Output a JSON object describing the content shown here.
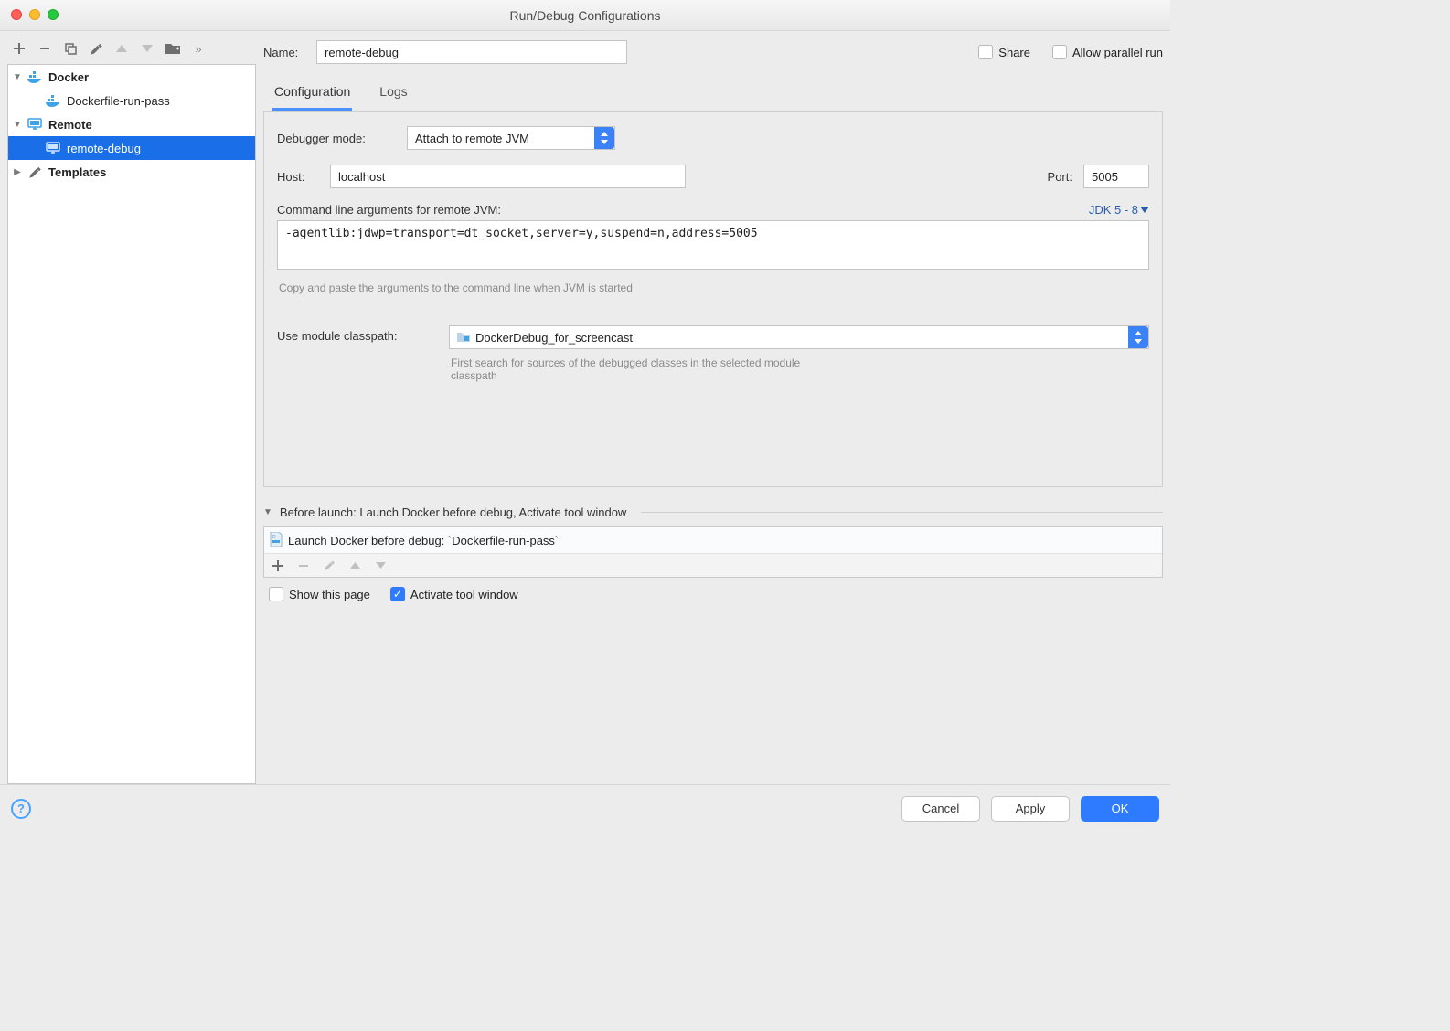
{
  "window": {
    "title": "Run/Debug Configurations"
  },
  "tree": {
    "docker_label": "Docker",
    "docker_child": "Dockerfile-run-pass",
    "remote_label": "Remote",
    "remote_child": "remote-debug",
    "templates_label": "Templates"
  },
  "name": {
    "label": "Name:",
    "value": "remote-debug"
  },
  "share": {
    "label": "Share"
  },
  "allow_parallel": {
    "label": "Allow parallel run"
  },
  "tabs": {
    "configuration": "Configuration",
    "logs": "Logs"
  },
  "config": {
    "debugger_mode_label": "Debugger mode:",
    "debugger_mode_value": "Attach to remote JVM",
    "host_label": "Host:",
    "host_value": "localhost",
    "port_label": "Port:",
    "port_value": "5005",
    "cmd_label": "Command line arguments for remote JVM:",
    "jdk_label": "JDK 5 - 8",
    "cmd_value": "-agentlib:jdwp=transport=dt_socket,server=y,suspend=n,address=5005",
    "cmd_hint": "Copy and paste the arguments to the command line when JVM is started",
    "module_label": "Use module classpath:",
    "module_value": "DockerDebug_for_screencast",
    "module_hint": "First search for sources of the debugged classes in the selected module classpath"
  },
  "before": {
    "header": "Before launch: Launch Docker before debug, Activate tool window",
    "task": "Launch Docker before debug: `Dockerfile-run-pass`"
  },
  "show_page": {
    "label": "Show this page"
  },
  "activate_tool": {
    "label": "Activate tool window"
  },
  "footer": {
    "cancel": "Cancel",
    "apply": "Apply",
    "ok": "OK"
  }
}
